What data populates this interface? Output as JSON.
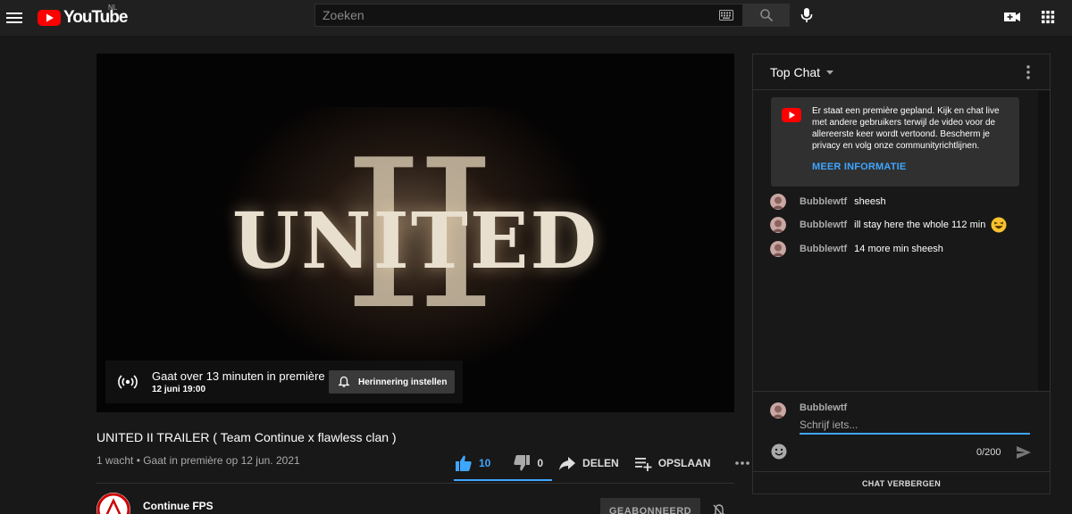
{
  "header": {
    "logo_text": "YouTube",
    "region": "NL",
    "search_placeholder": "Zoeken"
  },
  "video": {
    "title_art_main": "UNITED",
    "title_art_numeral": "II",
    "premiere_text": "Gaat over 13 minuten in première",
    "premiere_date": "12 juni 19:00",
    "reminder_label": "Herinnering instellen"
  },
  "info": {
    "title": "UNITED II TRAILER ( Team Continue x flawless clan )",
    "meta": "1 wacht • Gaat in première op 12 jun. 2021",
    "likes": "10",
    "dislikes": "0",
    "share_label": "DELEN",
    "save_label": "OPSLAAN"
  },
  "channel": {
    "name": "Continue FPS",
    "subscribed_label": "GEABONNEERD"
  },
  "chat": {
    "mode": "Top Chat",
    "notice_text": "Er staat een première gepland. Kijk en chat live met andere gebruikers terwijl de video voor de allereerste keer wordt vertoond. Bescherm je privacy en volg onze communityrichtlijnen.",
    "notice_link": "MEER INFORMATIE",
    "messages": [
      {
        "author": "Bubblewtf",
        "text": "sheesh"
      },
      {
        "author": "Bubblewtf",
        "text": "ill stay here the whole 112 min"
      },
      {
        "author": "Bubblewtf",
        "text": "14 more min sheesh"
      }
    ],
    "input_author": "Bubblewtf",
    "input_placeholder": "Schrijf iets...",
    "char_count": "0/200",
    "hide_label": "CHAT VERBERGEN"
  },
  "colors": {
    "accent_blue": "#3ea6ff",
    "yt_red": "#ff0000",
    "background": "#181818",
    "header_bg": "#202020"
  },
  "icons": [
    "menu-icon",
    "youtube-logo-icon",
    "keyboard-icon",
    "search-icon",
    "mic-icon",
    "create-video-icon",
    "apps-grid-icon",
    "live-broadcast-icon",
    "bell-icon",
    "thumbs-up-icon",
    "thumbs-down-icon",
    "share-icon",
    "playlist-add-icon",
    "more-horizontal-icon",
    "more-vertical-icon",
    "chevron-down-icon",
    "emoji-icon",
    "send-icon",
    "bell-off-icon"
  ]
}
